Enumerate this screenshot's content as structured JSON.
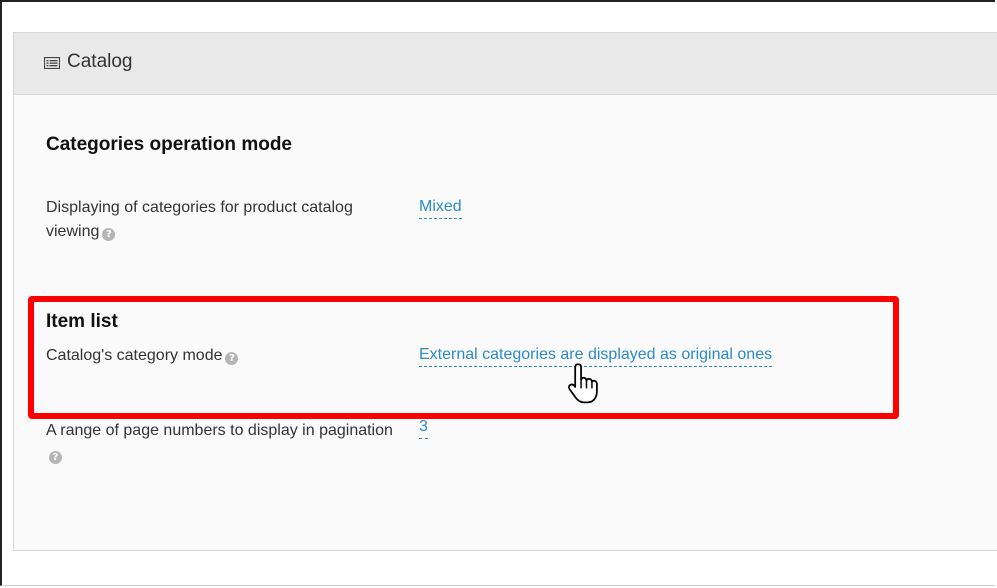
{
  "panel": {
    "title": "Catalog",
    "icon": "list-icon"
  },
  "section1": {
    "title": "Categories operation mode",
    "row": {
      "label": "Displaying of categories for product catalog viewing",
      "value": "Mixed",
      "help_icon": "question-circle-icon"
    }
  },
  "section2": {
    "title": "Item list",
    "row": {
      "label": "Catalog's category mode",
      "value": "External categories are displayed as original ones",
      "help_icon": "question-circle-icon"
    }
  },
  "row3": {
    "label": "A range of page numbers to display in pagination",
    "value": "3",
    "help_icon": "question-circle-icon"
  },
  "colors": {
    "link": "#2a8bc6",
    "highlight": "#ff0000",
    "header_bg": "#e9e9e9"
  },
  "cursor_icon": "hand-pointer-icon"
}
